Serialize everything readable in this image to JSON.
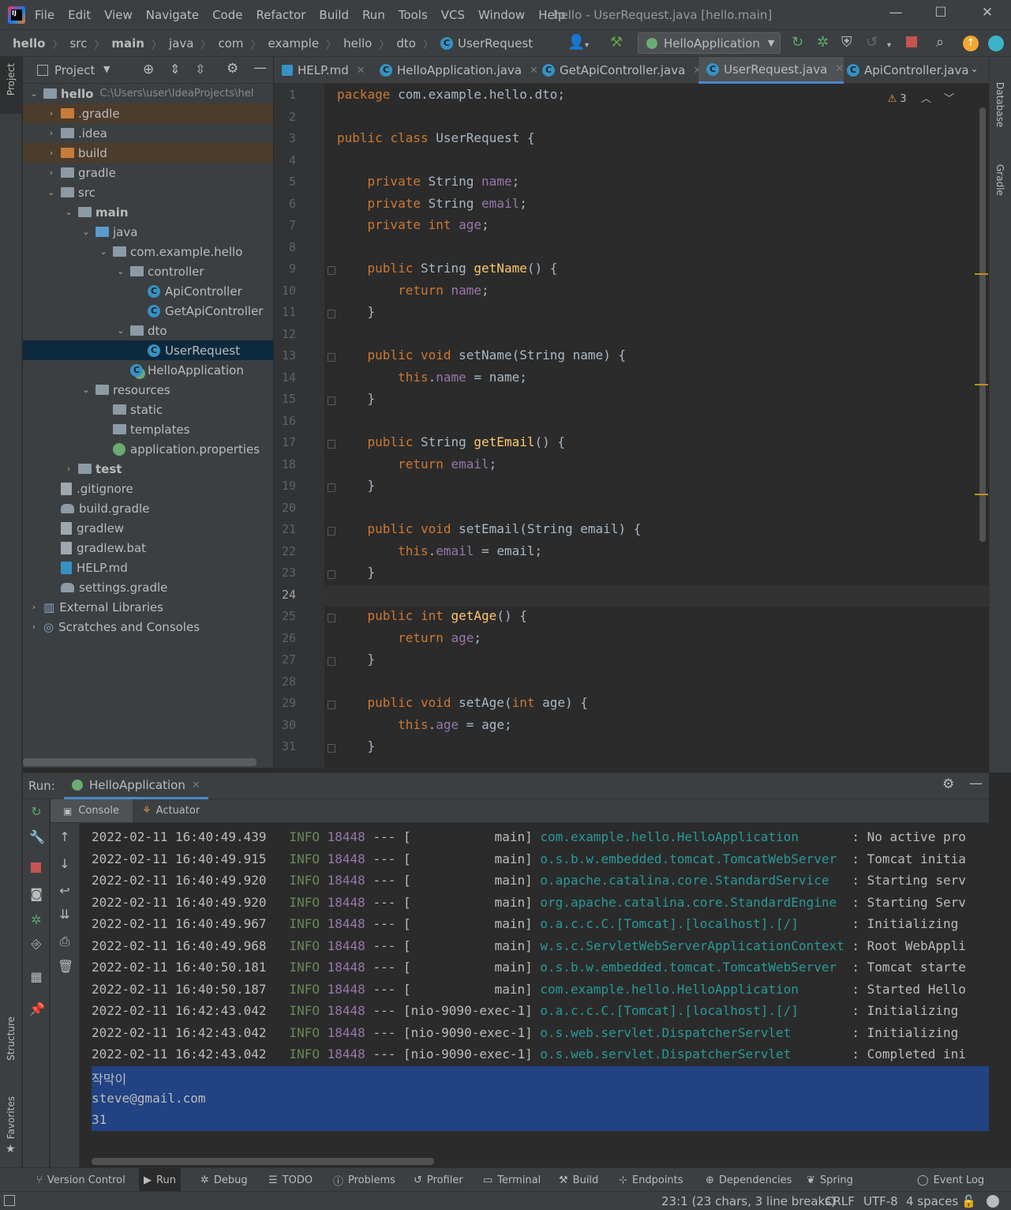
{
  "menubar": {
    "items": [
      "File",
      "Edit",
      "View",
      "Navigate",
      "Code",
      "Refactor",
      "Build",
      "Run",
      "Tools",
      "VCS",
      "Window",
      "Help"
    ],
    "window_title": "hello - UserRequest.java [hello.main]"
  },
  "breadcrumbs": [
    "hello",
    "src",
    "main",
    "java",
    "com",
    "example",
    "hello",
    "dto",
    "UserRequest"
  ],
  "run_config": "HelloApplication",
  "side_tools": {
    "project": "Project",
    "structure": "Structure",
    "favorites": "Favorites",
    "database": "Database",
    "gradle": "Gradle"
  },
  "project_panel": {
    "title": "Project",
    "root_path": "C:\\Users\\user\\IdeaProjects\\hel",
    "tree": [
      {
        "label": "hello",
        "icon": "folder-icon",
        "state": "expanded"
      },
      {
        "label": ".gradle",
        "icon": "folder-icon",
        "state": "collapsed"
      },
      {
        "label": ".idea",
        "icon": "folder-icon",
        "state": "collapsed"
      },
      {
        "label": "build",
        "icon": "folder-icon",
        "state": "collapsed"
      },
      {
        "label": "gradle",
        "icon": "folder-icon",
        "state": "collapsed"
      },
      {
        "label": "src",
        "icon": "folder-icon",
        "state": "expanded"
      },
      {
        "label": "main",
        "icon": "folder-icon",
        "state": "expanded"
      },
      {
        "label": "java",
        "icon": "folder-icon",
        "state": "expanded"
      },
      {
        "label": "com.example.hello",
        "icon": "package-icon",
        "state": "expanded"
      },
      {
        "label": "controller",
        "icon": "package-icon",
        "state": "expanded"
      },
      {
        "label": "ApiController",
        "icon": "class-icon",
        "state": "leaf"
      },
      {
        "label": "GetApiController",
        "icon": "class-icon",
        "state": "leaf"
      },
      {
        "label": "dto",
        "icon": "package-icon",
        "state": "expanded"
      },
      {
        "label": "UserRequest",
        "icon": "class-icon",
        "state": "selected"
      },
      {
        "label": "HelloApplication",
        "icon": "spring-class-icon",
        "state": "leaf"
      },
      {
        "label": "resources",
        "icon": "folder-icon",
        "state": "expanded"
      },
      {
        "label": "static",
        "icon": "folder-icon",
        "state": "leaf"
      },
      {
        "label": "templates",
        "icon": "folder-icon",
        "state": "leaf"
      },
      {
        "label": "application.properties",
        "icon": "spring-properties-icon",
        "state": "leaf"
      },
      {
        "label": "test",
        "icon": "folder-icon",
        "state": "collapsed"
      },
      {
        "label": ".gitignore",
        "icon": "file-icon",
        "state": "leaf"
      },
      {
        "label": "build.gradle",
        "icon": "gradle-icon",
        "state": "leaf"
      },
      {
        "label": "gradlew",
        "icon": "file-icon",
        "state": "leaf"
      },
      {
        "label": "gradlew.bat",
        "icon": "file-icon",
        "state": "leaf"
      },
      {
        "label": "HELP.md",
        "icon": "markdown-icon",
        "state": "leaf"
      },
      {
        "label": "settings.gradle",
        "icon": "gradle-icon",
        "state": "leaf"
      },
      {
        "label": "External Libraries",
        "icon": "library-icon",
        "state": "collapsed"
      },
      {
        "label": "Scratches and Consoles",
        "icon": "scratches-icon",
        "state": "collapsed"
      }
    ]
  },
  "editor_tabs": [
    "HELP.md",
    "HelloApplication.java",
    "GetApiController.java",
    "UserRequest.java",
    "ApiController.java"
  ],
  "editor": {
    "warnings": "3",
    "current_line": "24",
    "lines": [
      "package com.example.hello.dto;",
      "",
      "public class UserRequest {",
      "",
      "    private String name;",
      "    private String email;",
      "    private int age;",
      "",
      "    public String getName() {",
      "        return name;",
      "    }",
      "",
      "    public void setName(String name) {",
      "        this.name = name;",
      "    }",
      "",
      "    public String getEmail() {",
      "        return email;",
      "    }",
      "",
      "    public void setEmail(String email) {",
      "        this.email = email;",
      "    }",
      "",
      "    public int getAge() {",
      "        return age;",
      "    }",
      "",
      "    public void setAge(int age) {",
      "        this.age = age;",
      "    }"
    ]
  },
  "run_panel": {
    "label": "Run:",
    "tab": "HelloApplication",
    "subtabs": [
      "Console",
      "Actuator"
    ],
    "log": [
      {
        "ts": "2022-02-11 16:40:49.439",
        "level": "INFO",
        "pid": "18448",
        "sep": "---",
        "thread": "[           main]",
        "logger": "com.example.hello.HelloApplication      ",
        "msg": ": No active pro"
      },
      {
        "ts": "2022-02-11 16:40:49.915",
        "level": "INFO",
        "pid": "18448",
        "sep": "---",
        "thread": "[           main]",
        "logger": "o.s.b.w.embedded.tomcat.TomcatWebServer ",
        "msg": ": Tomcat initia"
      },
      {
        "ts": "2022-02-11 16:40:49.920",
        "level": "INFO",
        "pid": "18448",
        "sep": "---",
        "thread": "[           main]",
        "logger": "o.apache.catalina.core.StandardService  ",
        "msg": ": Starting serv"
      },
      {
        "ts": "2022-02-11 16:40:49.920",
        "level": "INFO",
        "pid": "18448",
        "sep": "---",
        "thread": "[           main]",
        "logger": "org.apache.catalina.core.StandardEngine ",
        "msg": ": Starting Serv"
      },
      {
        "ts": "2022-02-11 16:40:49.967",
        "level": "INFO",
        "pid": "18448",
        "sep": "---",
        "thread": "[           main]",
        "logger": "o.a.c.c.C.[Tomcat].[localhost].[/]      ",
        "msg": ": Initializing"
      },
      {
        "ts": "2022-02-11 16:40:49.968",
        "level": "INFO",
        "pid": "18448",
        "sep": "---",
        "thread": "[           main]",
        "logger": "w.s.c.ServletWebServerApplicationContext",
        "msg": ": Root WebAppli"
      },
      {
        "ts": "2022-02-11 16:40:50.181",
        "level": "INFO",
        "pid": "18448",
        "sep": "---",
        "thread": "[           main]",
        "logger": "o.s.b.w.embedded.tomcat.TomcatWebServer ",
        "msg": ": Tomcat starte"
      },
      {
        "ts": "2022-02-11 16:40:50.187",
        "level": "INFO",
        "pid": "18448",
        "sep": "---",
        "thread": "[           main]",
        "logger": "com.example.hello.HelloApplication      ",
        "msg": ": Started Hello"
      },
      {
        "ts": "2022-02-11 16:42:43.042",
        "level": "INFO",
        "pid": "18448",
        "sep": "---",
        "thread": "[nio-9090-exec-1]",
        "logger": "o.a.c.c.C.[Tomcat].[localhost].[/]      ",
        "msg": ": Initializing"
      },
      {
        "ts": "2022-02-11 16:42:43.042",
        "level": "INFO",
        "pid": "18448",
        "sep": "---",
        "thread": "[nio-9090-exec-1]",
        "logger": "o.s.web.servlet.DispatcherServlet       ",
        "msg": ": Initializing"
      },
      {
        "ts": "2022-02-11 16:42:43.042",
        "level": "INFO",
        "pid": "18448",
        "sep": "---",
        "thread": "[nio-9090-exec-1]",
        "logger": "o.s.web.servlet.DispatcherServlet       ",
        "msg": ": Completed ini"
      }
    ],
    "output": [
      "작막이",
      "steve@gmail.com",
      "31"
    ]
  },
  "bottom_tools": [
    "Version Control",
    "Run",
    "Debug",
    "TODO",
    "Problems",
    "Profiler",
    "Terminal",
    "Build",
    "Endpoints",
    "Dependencies",
    "Spring",
    "Event Log"
  ],
  "status": {
    "position": "23:1 (23 chars, 3 line breaks)",
    "line_sep": "CRLF",
    "encoding": "UTF-8",
    "indent": "4 spaces"
  }
}
